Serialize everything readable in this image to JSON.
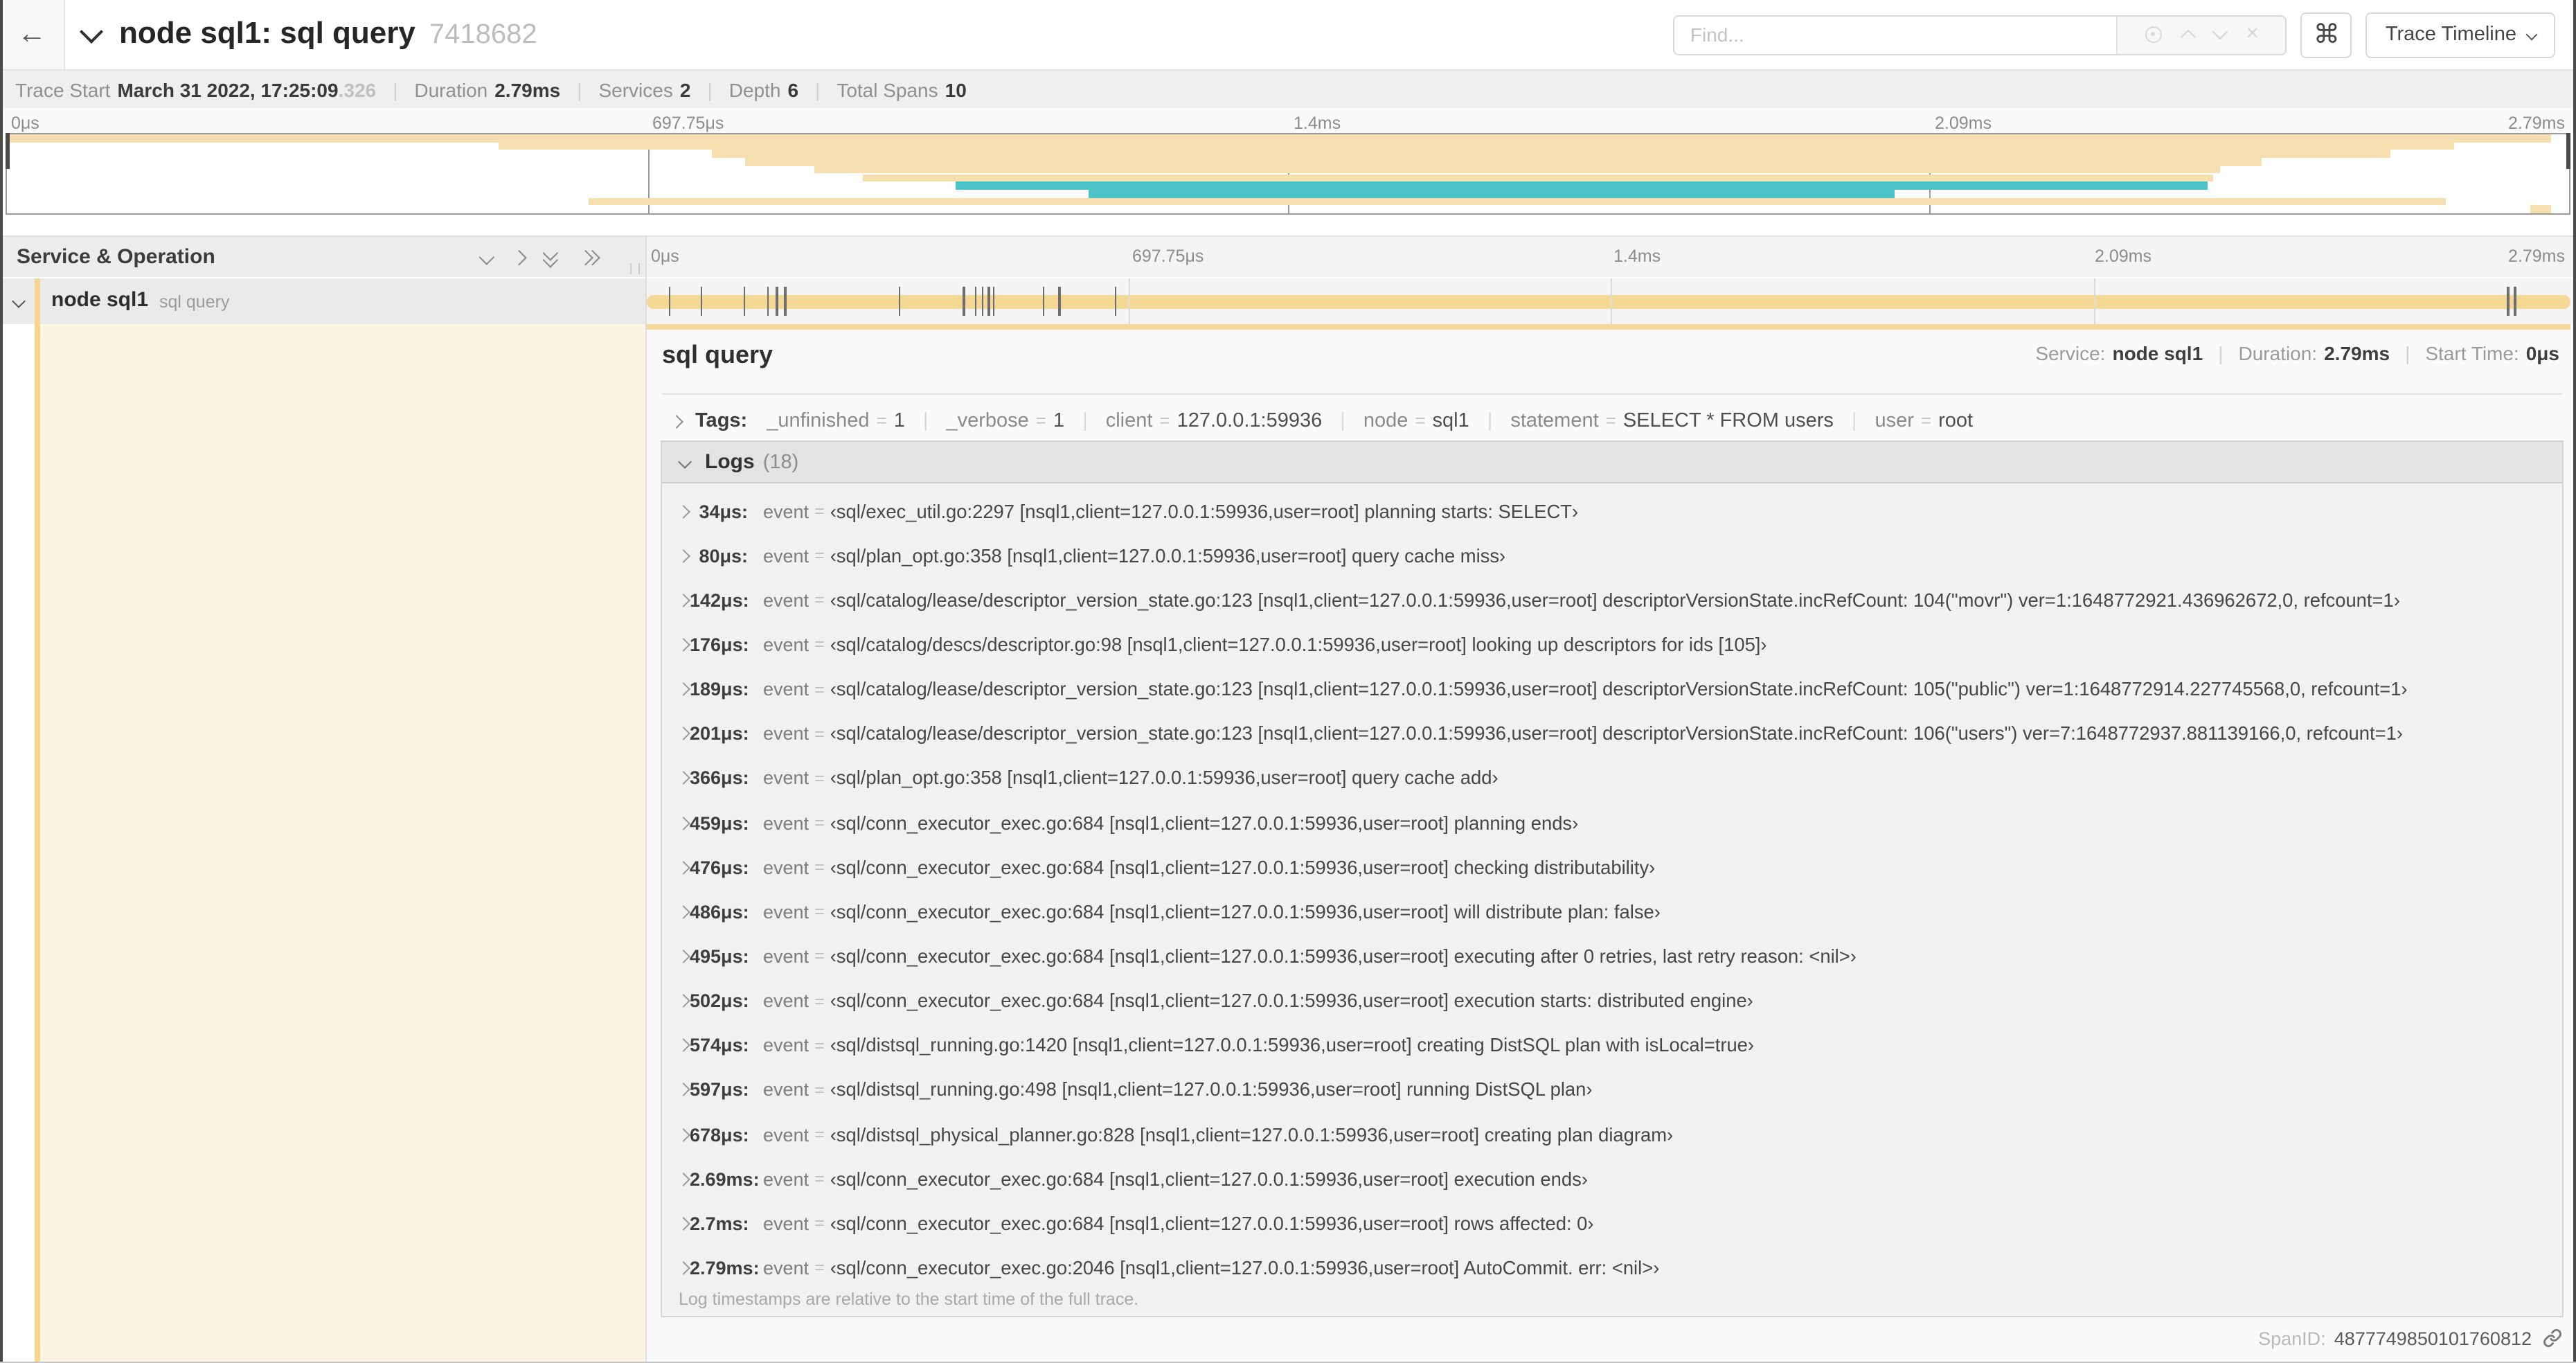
{
  "header": {
    "back_icon": "←",
    "title": "node sql1: sql query",
    "trace_id": "7418682",
    "find_placeholder": "Find...",
    "keyboard_shortcut_label": "⌘",
    "view_selector_label": "Trace Timeline"
  },
  "summary": {
    "items": [
      {
        "label": "Trace Start",
        "value": "March 31 2022, 17:25:09",
        "suffix": ".326"
      },
      {
        "label": "Duration",
        "value": "2.79ms"
      },
      {
        "label": "Services",
        "value": "2"
      },
      {
        "label": "Depth",
        "value": "6"
      },
      {
        "label": "Total Spans",
        "value": "10"
      }
    ]
  },
  "ruler_labels": [
    "0μs",
    "697.75μs",
    "1.4ms",
    "2.09ms",
    "2.79ms"
  ],
  "minimap": {
    "colors": {
      "tan": "#f6dfae",
      "teal": "#4bc3c9"
    },
    "spans": [
      {
        "start": 0.0,
        "end": 99.3,
        "color": "tan"
      },
      {
        "start": 19.2,
        "end": 95.5,
        "color": "tan"
      },
      {
        "start": 27.5,
        "end": 93.0,
        "color": "tan"
      },
      {
        "start": 28.8,
        "end": 88.0,
        "color": "tan"
      },
      {
        "start": 31.5,
        "end": 86.4,
        "color": "tan"
      },
      {
        "start": 33.4,
        "end": 86.1,
        "color": "tan"
      },
      {
        "start": 37.0,
        "end": 85.9,
        "color": "teal"
      },
      {
        "start": 42.2,
        "end": 73.7,
        "color": "teal"
      },
      {
        "start": 22.7,
        "end": 95.2,
        "color": "tan"
      },
      {
        "start": 98.5,
        "end": 99.3,
        "color": "tan"
      }
    ]
  },
  "columns": {
    "left_header": "Service & Operation"
  },
  "row": {
    "service": "node sql1",
    "operation": "sql query"
  },
  "timeline": {
    "total_us": 2790
  },
  "detail": {
    "title": "sql query",
    "meta": [
      {
        "label": "Service:",
        "value": "node sql1"
      },
      {
        "label": "Duration:",
        "value": "2.79ms"
      },
      {
        "label": "Start Time:",
        "value": "0μs"
      }
    ],
    "tags_label": "Tags:",
    "tags": [
      {
        "key": "_unfinished",
        "value": "1"
      },
      {
        "key": "_verbose",
        "value": "1"
      },
      {
        "key": "client",
        "value": "127.0.0.1:59936"
      },
      {
        "key": "node",
        "value": "sql1"
      },
      {
        "key": "statement",
        "value": "SELECT * FROM users"
      },
      {
        "key": "user",
        "value": "root"
      }
    ],
    "logs_label": "Logs",
    "logs_count": "(18)",
    "log_field": "event",
    "logs": [
      {
        "t": "34μs:",
        "us": 34,
        "msg": "‹sql/exec_util.go:2297 [nsql1,client=127.0.0.1:59936,user=root] planning starts: SELECT›"
      },
      {
        "t": "80μs:",
        "us": 80,
        "msg": "‹sql/plan_opt.go:358 [nsql1,client=127.0.0.1:59936,user=root] query cache miss›"
      },
      {
        "t": "142μs:",
        "us": 142,
        "msg": "‹sql/catalog/lease/descriptor_version_state.go:123 [nsql1,client=127.0.0.1:59936,user=root] descriptorVersionState.incRefCount: 104(\"movr\") ver=1:1648772921.436962672,0, refcount=1›"
      },
      {
        "t": "176μs:",
        "us": 176,
        "msg": "‹sql/catalog/descs/descriptor.go:98 [nsql1,client=127.0.0.1:59936,user=root] looking up descriptors for ids [105]›"
      },
      {
        "t": "189μs:",
        "us": 189,
        "msg": "‹sql/catalog/lease/descriptor_version_state.go:123 [nsql1,client=127.0.0.1:59936,user=root] descriptorVersionState.incRefCount: 105(\"public\") ver=1:1648772914.227745568,0, refcount=1›"
      },
      {
        "t": "201μs:",
        "us": 201,
        "msg": "‹sql/catalog/lease/descriptor_version_state.go:123 [nsql1,client=127.0.0.1:59936,user=root] descriptorVersionState.incRefCount: 106(\"users\") ver=7:1648772937.881139166,0, refcount=1›"
      },
      {
        "t": "366μs:",
        "us": 366,
        "msg": "‹sql/plan_opt.go:358 [nsql1,client=127.0.0.1:59936,user=root] query cache add›"
      },
      {
        "t": "459μs:",
        "us": 459,
        "msg": "‹sql/conn_executor_exec.go:684 [nsql1,client=127.0.0.1:59936,user=root] planning ends›"
      },
      {
        "t": "476μs:",
        "us": 476,
        "msg": "‹sql/conn_executor_exec.go:684 [nsql1,client=127.0.0.1:59936,user=root] checking distributability›"
      },
      {
        "t": "486μs:",
        "us": 486,
        "msg": "‹sql/conn_executor_exec.go:684 [nsql1,client=127.0.0.1:59936,user=root] will distribute plan: false›"
      },
      {
        "t": "495μs:",
        "us": 495,
        "msg": "‹sql/conn_executor_exec.go:684 [nsql1,client=127.0.0.1:59936,user=root] executing after 0 retries, last retry reason: <nil>›"
      },
      {
        "t": "502μs:",
        "us": 502,
        "msg": "‹sql/conn_executor_exec.go:684 [nsql1,client=127.0.0.1:59936,user=root] execution starts: distributed engine›"
      },
      {
        "t": "574μs:",
        "us": 574,
        "msg": "‹sql/distsql_running.go:1420 [nsql1,client=127.0.0.1:59936,user=root] creating DistSQL plan with isLocal=true›"
      },
      {
        "t": "597μs:",
        "us": 597,
        "msg": "‹sql/distsql_running.go:498 [nsql1,client=127.0.0.1:59936,user=root] running DistSQL plan›"
      },
      {
        "t": "678μs:",
        "us": 678,
        "msg": "‹sql/distsql_physical_planner.go:828 [nsql1,client=127.0.0.1:59936,user=root] creating plan diagram›"
      },
      {
        "t": "2.69ms:",
        "us": 2690,
        "msg": "‹sql/conn_executor_exec.go:684 [nsql1,client=127.0.0.1:59936,user=root] execution ends›"
      },
      {
        "t": "2.7ms:",
        "us": 2700,
        "msg": "‹sql/conn_executor_exec.go:684 [nsql1,client=127.0.0.1:59936,user=root] rows affected: 0›"
      },
      {
        "t": "2.79ms:",
        "us": 2790,
        "msg": "‹sql/conn_executor_exec.go:2046 [nsql1,client=127.0.0.1:59936,user=root] AutoCommit. err: <nil>›"
      }
    ],
    "note": "Log timestamps are relative to the start time of the full trace.",
    "span_id_label": "SpanID:",
    "span_id": "4877749850101760812"
  }
}
